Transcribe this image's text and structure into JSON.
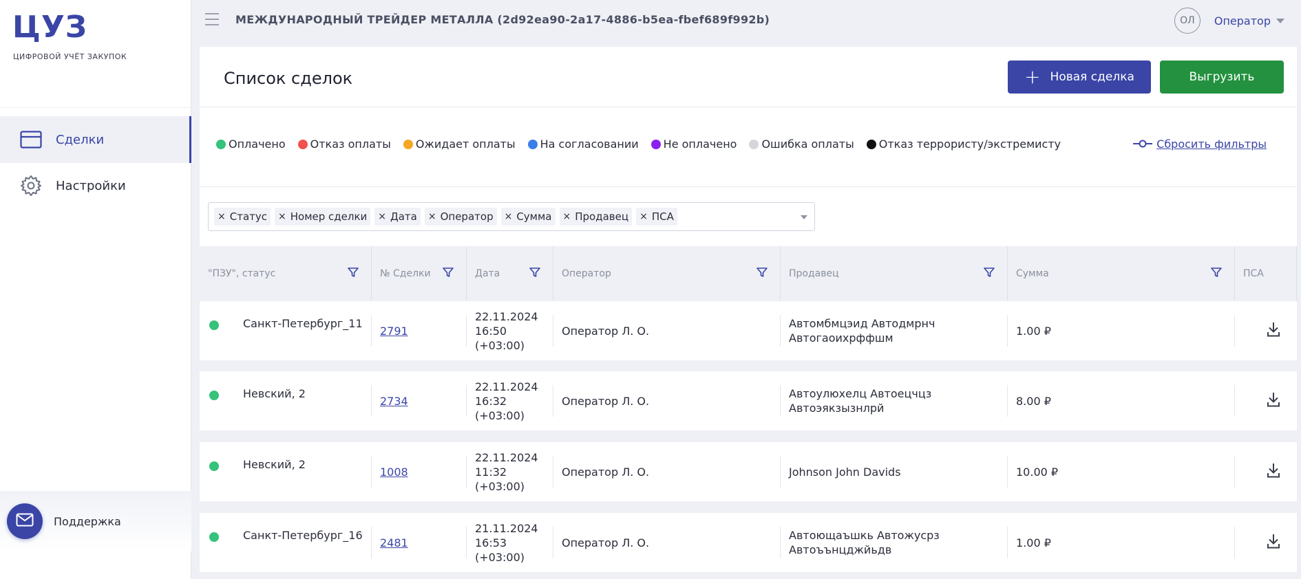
{
  "app": {
    "logo": "ЦУЗ",
    "logo_subtitle": "ЦИФРОВОЙ УЧЁТ ЗАКУПОК"
  },
  "sidebar": {
    "items": [
      {
        "label": "Сделки",
        "icon": "card-icon",
        "active": true
      },
      {
        "label": "Настройки",
        "icon": "gear-icon",
        "active": false
      }
    ],
    "support_label": "Поддержка"
  },
  "topbar": {
    "company": "МЕЖДУНАРОДНЫЙ ТРЕЙДЕР МЕТАЛЛА (2d92ea90-2a17-4886-b5ea-fbef689f992b)",
    "avatar_initials": "ОЛ",
    "role": "Оператор"
  },
  "page": {
    "title": "Список сделок",
    "new_deal_label": "Новая сделка",
    "export_label": "Выгрузить"
  },
  "legend": {
    "items": [
      {
        "label": "Оплачено",
        "color": "#35c27a"
      },
      {
        "label": "Отказ оплаты",
        "color": "#f0524f"
      },
      {
        "label": "Ожидает оплаты",
        "color": "#f5a623"
      },
      {
        "label": "На согласовании",
        "color": "#3b7ee8"
      },
      {
        "label": "Не оплачено",
        "color": "#8a1ff0"
      },
      {
        "label": "Ошибка оплаты",
        "color": "#d4d6dc"
      },
      {
        "label": "Отказ террористу/экстремисту",
        "color": "#111111"
      }
    ],
    "reset_label": "Сбросить фильтры"
  },
  "filters": {
    "tags": [
      "Статус",
      "Номер сделки",
      "Дата",
      "Оператор",
      "Сумма",
      "Продавец",
      "ПСА"
    ]
  },
  "table": {
    "columns": [
      "\"ПЗУ\", статус",
      "№ Сделки",
      "Дата",
      "Оператор",
      "Продавец",
      "Сумма",
      "ПСА"
    ],
    "rows": [
      {
        "pzu": "Санкт-Петербург_11",
        "deal": "2791",
        "date": [
          "22.11.2024",
          "16:50",
          "(+03:00)"
        ],
        "operator": "Оператор Л. О.",
        "seller": [
          "Автомбмцэид Автодмрнч",
          "Автогаоихрффшм"
        ],
        "amount": "1.00 ₽",
        "status_color": "#35c27a"
      },
      {
        "pzu": "Невский, 2",
        "deal": "2734",
        "date": [
          "22.11.2024",
          "16:32",
          "(+03:00)"
        ],
        "operator": "Оператор Л. О.",
        "seller": [
          "Автоулюхелц Автоецчцз",
          "Автоэякзызнлрй"
        ],
        "amount": "8.00 ₽",
        "status_color": "#35c27a"
      },
      {
        "pzu": "Невский, 2",
        "deal": "1008",
        "date": [
          "22.11.2024",
          "11:32",
          "(+03:00)"
        ],
        "operator": "Оператор Л. О.",
        "seller": [
          "Johnson John Davids",
          ""
        ],
        "amount": "10.00 ₽",
        "status_color": "#35c27a"
      },
      {
        "pzu": "Санкт-Петербург_16",
        "deal": "2481",
        "date": [
          "21.11.2024",
          "16:53",
          "(+03:00)"
        ],
        "operator": "Оператор Л. О.",
        "seller": [
          "Автоющаъшкь Автожусрз",
          "Автоъънцджйьдв"
        ],
        "amount": "1.00 ₽",
        "status_color": "#35c27a"
      }
    ]
  }
}
